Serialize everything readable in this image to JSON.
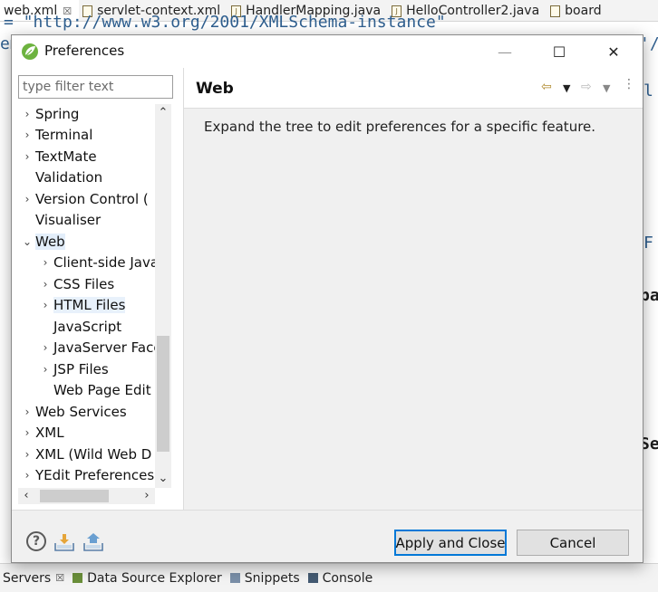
{
  "ide": {
    "tabs": [
      {
        "label": "web.xml",
        "close": "☒",
        "active": true
      },
      {
        "label": "servlet-context.xml",
        "active": false
      },
      {
        "label": "HandlerMapping.java",
        "active": false
      },
      {
        "label": "HelloController2.java",
        "active": false
      },
      {
        "label": "board",
        "active": false
      }
    ],
    "editor_fragments": [
      {
        "text": "= \"http://www.w3.org/2001/XMLSchema-instance\"",
        "color": "#2f5f8f"
      },
      {
        "text": "em",
        "color": "#2f5f8f"
      },
      {
        "text": "'/j",
        "color": "#2f5f8f"
      },
      {
        "text": "l",
        "color": "#2f5f8f"
      },
      {
        "text": "F",
        "color": "#2f5f8f"
      },
      {
        "text": "pa",
        "color": "#1d1d1d"
      },
      {
        "text": "Se",
        "color": "#1d1d1d"
      }
    ],
    "bottom_tabs": [
      {
        "label": "Servers",
        "close": "☒"
      },
      {
        "label": "Data Source Explorer"
      },
      {
        "label": "Snippets"
      },
      {
        "label": "Console"
      }
    ]
  },
  "dialog": {
    "title": "Preferences",
    "window_controls": {
      "minimize": "—",
      "maximize": "☐",
      "close": "✕"
    },
    "filter": {
      "placeholder": "type filter text",
      "value": ""
    },
    "tree": [
      {
        "label": "Spring",
        "level": 0,
        "chevron": "›",
        "expandable": true
      },
      {
        "label": "Terminal",
        "level": 0,
        "chevron": "›",
        "expandable": true
      },
      {
        "label": "TextMate",
        "level": 0,
        "chevron": "›",
        "expandable": true
      },
      {
        "label": "Validation",
        "level": 0,
        "chevron": "",
        "expandable": false
      },
      {
        "label": "Version Control (",
        "level": 0,
        "chevron": "›",
        "expandable": true
      },
      {
        "label": "Visualiser",
        "level": 0,
        "chevron": "",
        "expandable": false
      },
      {
        "label": "Web",
        "level": 0,
        "chevron": "⌄",
        "expandable": true,
        "expanded": true,
        "selected": true
      },
      {
        "label": "Client-side Java",
        "level": 1,
        "chevron": "›",
        "expandable": true
      },
      {
        "label": "CSS Files",
        "level": 1,
        "chevron": "›",
        "expandable": true
      },
      {
        "label": "HTML Files",
        "level": 1,
        "chevron": "›",
        "expandable": true,
        "hovered": true
      },
      {
        "label": "JavaScript",
        "level": 1,
        "chevron": "",
        "expandable": false
      },
      {
        "label": "JavaServer Face",
        "level": 1,
        "chevron": "›",
        "expandable": true
      },
      {
        "label": "JSP Files",
        "level": 1,
        "chevron": "›",
        "expandable": true
      },
      {
        "label": "Web Page Edit",
        "level": 1,
        "chevron": "",
        "expandable": false
      },
      {
        "label": "Web Services",
        "level": 0,
        "chevron": "›",
        "expandable": true
      },
      {
        "label": "XML",
        "level": 0,
        "chevron": "›",
        "expandable": true
      },
      {
        "label": "XML (Wild Web D",
        "level": 0,
        "chevron": "›",
        "expandable": true
      },
      {
        "label": "YEdit Preferences",
        "level": 0,
        "chevron": "›",
        "expandable": true
      }
    ],
    "scroll_arrows": {
      "up": "⌃",
      "down": "⌄",
      "left": "‹",
      "right": "›"
    },
    "page": {
      "title": "Web",
      "description": "Expand the tree to edit preferences for a specific feature.",
      "nav": {
        "back": "⇦",
        "back_menu": "▼",
        "forward": "⇨",
        "forward_menu": "▼",
        "more": "⋮"
      }
    },
    "buttons": {
      "help": "?",
      "apply_close": "Apply and Close",
      "cancel": "Cancel"
    },
    "colors": {
      "accent": "#0078d7",
      "selection": "#e3eefa",
      "panel": "#f0f0f0"
    }
  }
}
